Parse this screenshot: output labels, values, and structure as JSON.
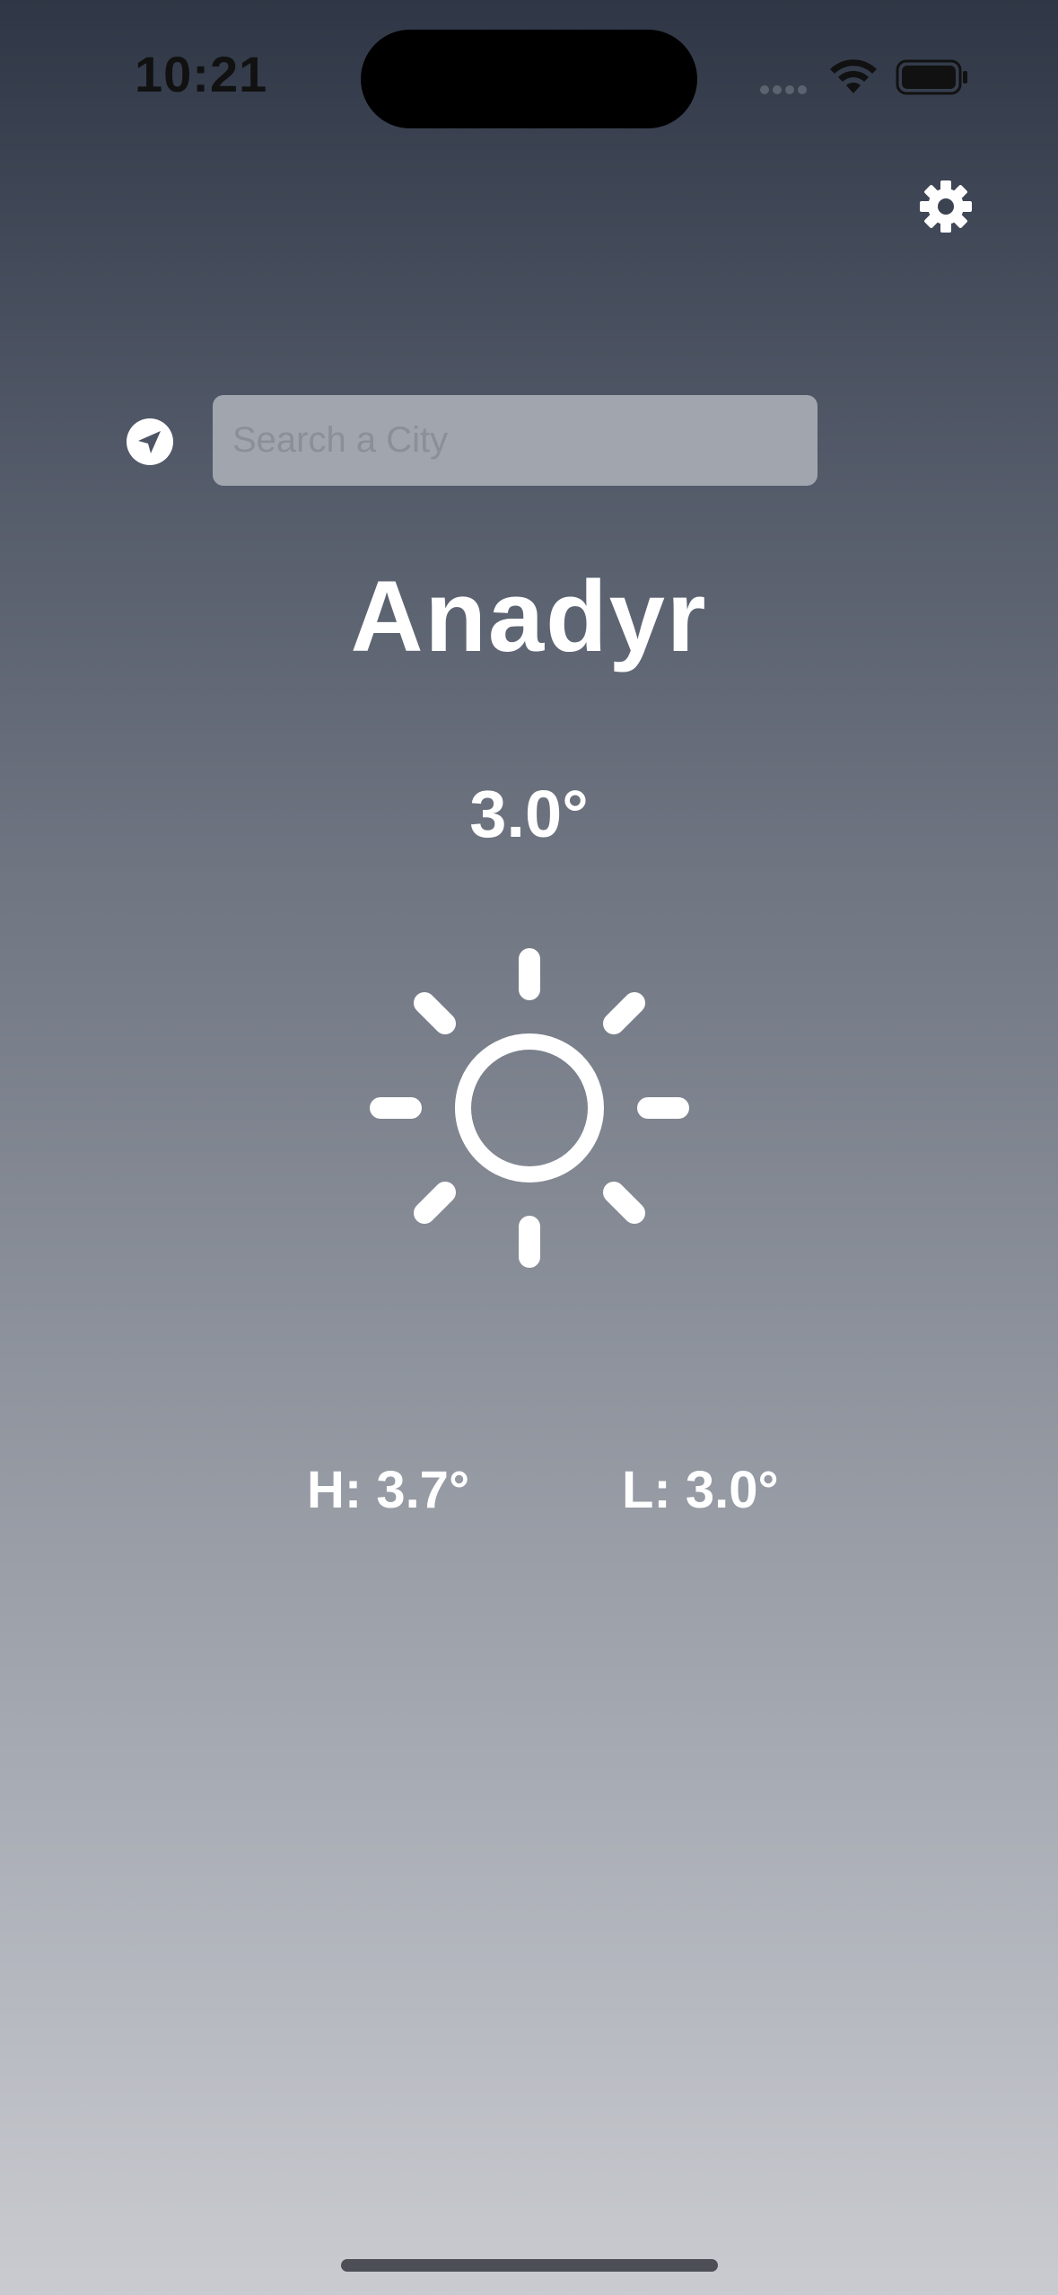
{
  "status_bar": {
    "time": "10:21",
    "icons": [
      "signal-dots-icon",
      "wifi-icon",
      "battery-icon"
    ]
  },
  "header": {
    "settings_icon": "gear-icon"
  },
  "search": {
    "location_icon": "location-arrow-icon",
    "placeholder": "Search a City",
    "value": ""
  },
  "weather": {
    "city": "Anadyr",
    "temperature": "3.0°",
    "condition_icon": "sun-icon",
    "high": "H: 3.7°",
    "low": "L: 3.0°"
  },
  "colors": {
    "text": "#ffffff",
    "search_background": "#a1a5ae",
    "gradient_top": "#2f3746",
    "gradient_bottom": "#c9cbd0"
  }
}
